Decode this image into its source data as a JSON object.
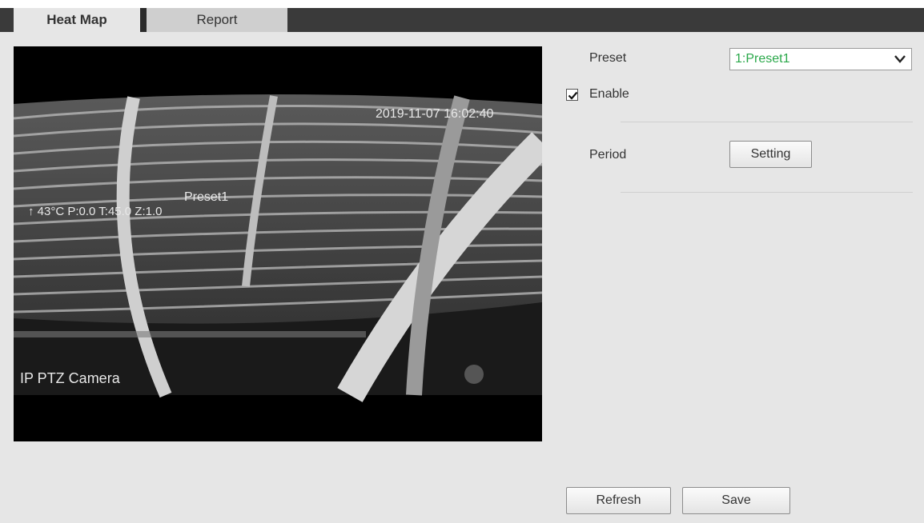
{
  "tabs": [
    {
      "label": "Heat Map",
      "active": true
    },
    {
      "label": "Report",
      "active": false
    }
  ],
  "video": {
    "timestamp": "2019-11-07 16:02:40",
    "preset_overlay": "Preset1",
    "ptz_overlay": "↑ 43°C P:0.0 T:45.0 Z:1.0",
    "camera_name": "IP PTZ Camera"
  },
  "form": {
    "preset_label": "Preset",
    "preset_value": "1:Preset1",
    "enable_label": "Enable",
    "enable_checked": true,
    "period_label": "Period",
    "setting_button": "Setting"
  },
  "actions": {
    "refresh": "Refresh",
    "save": "Save"
  },
  "colors": {
    "preset_value": "#2aa84a",
    "tabbar": "#3a3a3a",
    "page_bg": "#e6e6e6"
  },
  "icons": {
    "dropdown": "chevron-down-icon",
    "checkbox": "checkmark-icon"
  }
}
